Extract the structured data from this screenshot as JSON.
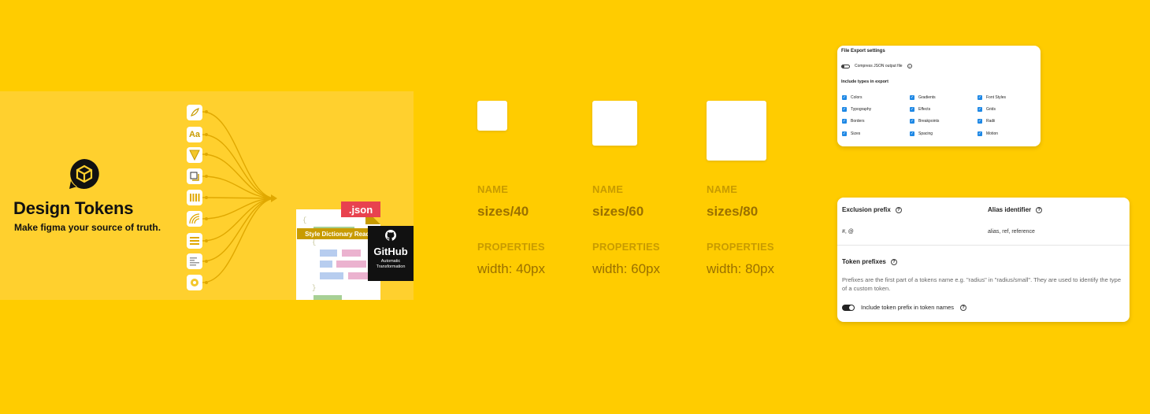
{
  "hero": {
    "title": "Design Tokens",
    "subtitle": "Make figma your source of truth.",
    "file_tag": ".json",
    "ready_label": "Style Dictionary Ready",
    "github": {
      "title": "GitHub",
      "subtitle_line1": "Automatic",
      "subtitle_line2": "Transformation"
    },
    "icons": [
      "feather-icon",
      "text-style-icon",
      "gradient-icon",
      "effect-icon",
      "grid-icon",
      "radius-icon",
      "typography-icon",
      "document-icon",
      "motion-icon"
    ],
    "icon_text": {
      "text_style": "Aa"
    },
    "accent": "#C89B00"
  },
  "tokens": [
    {
      "name_label": "NAME",
      "name": "sizes/40",
      "props_label": "PROPERTIES",
      "value": "width: 40px"
    },
    {
      "name_label": "NAME",
      "name": "sizes/60",
      "props_label": "PROPERTIES",
      "value": "width: 60px"
    },
    {
      "name_label": "NAME",
      "name": "sizes/80",
      "props_label": "PROPERTIES",
      "value": "width: 80px"
    }
  ],
  "export_settings": {
    "title": "File Export settings",
    "compress_label": "Compress JSON output file",
    "types_title": "Include types in export",
    "types": [
      "Colors",
      "Gradients",
      "Font Styles",
      "Typography",
      "Effects",
      "Grids",
      "Borders",
      "Breakpoints",
      "Radii",
      "Sizes",
      "Spacing",
      "Motion"
    ]
  },
  "prefix_settings": {
    "exclusion_label": "Exclusion prefix",
    "exclusion_value": "#, @",
    "alias_label": "Alias identifier",
    "alias_value": "alias, ref, reference",
    "token_prefixes_label": "Token prefixes",
    "description": "Prefixes are the first part of a tokens name e.g. \"radius\" in \"radius/small\". They are used to identify the type of a custom token.",
    "include_prefix_label": "Include token prefix in token names"
  },
  "colors": {
    "background": "#FFCC00",
    "checkbox": "#1E88E5",
    "json_tag": "#E8424F"
  }
}
